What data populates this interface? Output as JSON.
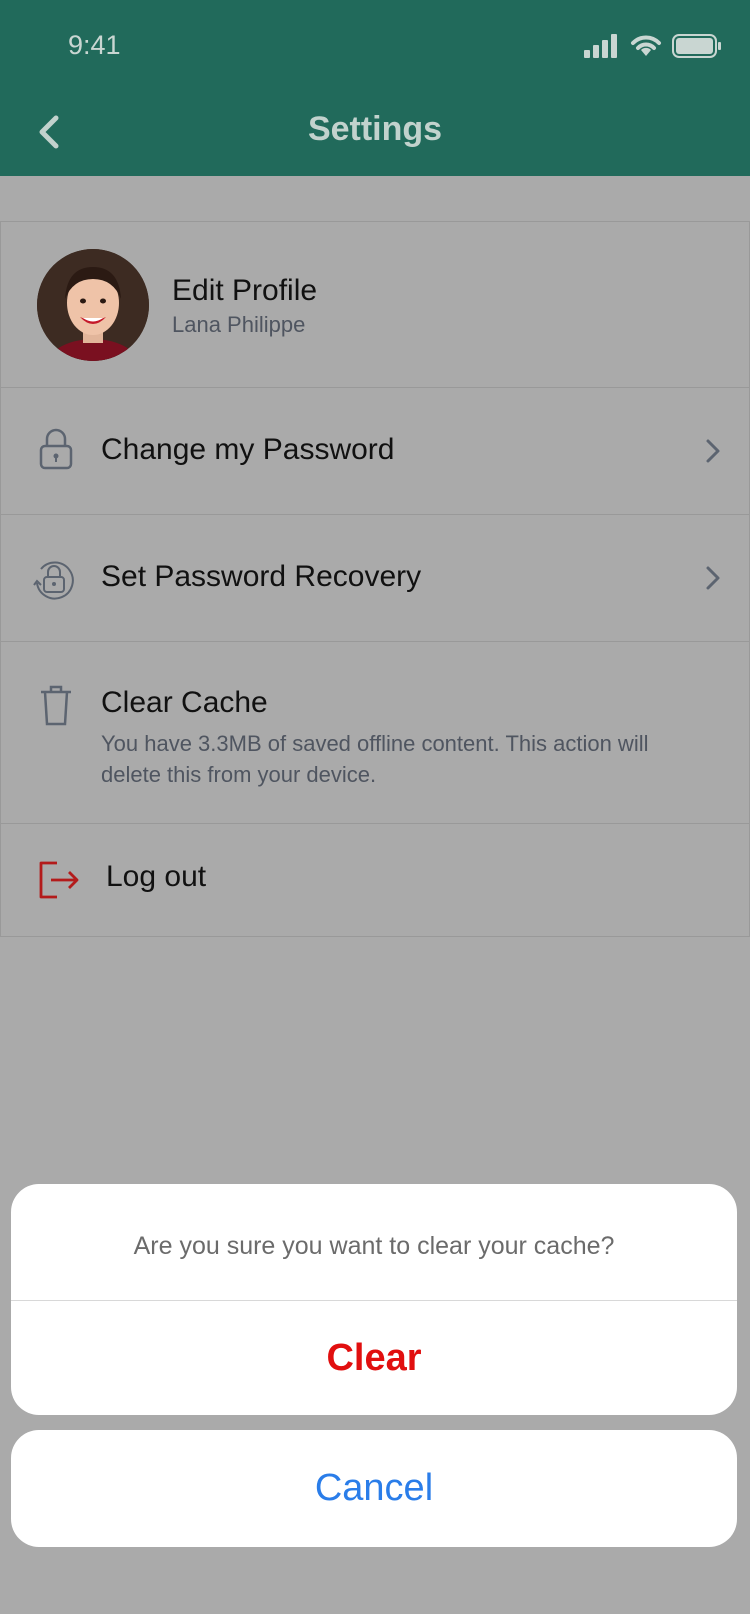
{
  "status_bar": {
    "time": "9:41"
  },
  "header": {
    "title": "Settings"
  },
  "settings": {
    "profile": {
      "title": "Edit Profile",
      "name": "Lana Philippe"
    },
    "change_password": {
      "label": "Change my Password"
    },
    "password_recovery": {
      "label": "Set Password Recovery"
    },
    "clear_cache": {
      "label": "Clear Cache",
      "description": "You have 3.3MB of saved offline content. This action will delete this from your device."
    },
    "logout": {
      "label": "Log out"
    }
  },
  "action_sheet": {
    "message": "Are you sure you want to clear your cache?",
    "confirm_label": "Clear",
    "cancel_label": "Cancel"
  },
  "colors": {
    "header_bg": "#216a5b",
    "destructive": "#e10f0f",
    "cancel": "#2a7de9",
    "logout_icon": "#b31b1b"
  },
  "icons": [
    "back-chevron-icon",
    "signal-icon",
    "wifi-icon",
    "battery-icon",
    "lock-icon",
    "lock-recovery-icon",
    "trash-icon",
    "logout-icon",
    "chevron-right-icon"
  ]
}
